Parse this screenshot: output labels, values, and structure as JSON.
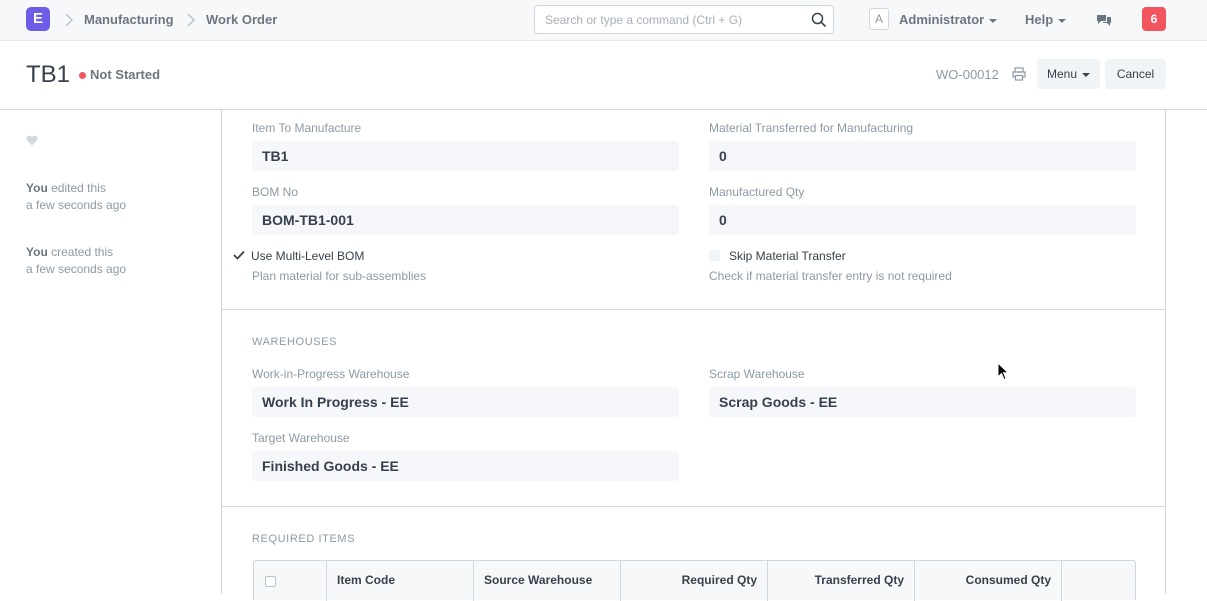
{
  "navbar": {
    "logo_letter": "E",
    "breadcrumbs": [
      "Manufacturing",
      "Work Order"
    ],
    "search_placeholder": "Search or type a command (Ctrl + G)",
    "avatar_letter": "A",
    "user": "Administrator",
    "help": "Help",
    "notification_count": "6"
  },
  "page": {
    "title": "TB1",
    "status": "Not Started",
    "docname": "WO-00012",
    "menu_label": "Menu",
    "cancel_label": "Cancel"
  },
  "sidebar": {
    "activities": [
      {
        "who": "You",
        "action": " edited this",
        "when": "a few seconds ago"
      },
      {
        "who": "You",
        "action": " created this",
        "when": "a few seconds ago"
      }
    ]
  },
  "form": {
    "item_to_manufacture": {
      "label": "Item To Manufacture",
      "value": "TB1"
    },
    "material_transferred": {
      "label": "Material Transferred for Manufacturing",
      "value": "0"
    },
    "bom_no": {
      "label": "BOM No",
      "value": "BOM-TB1-001"
    },
    "manufactured_qty": {
      "label": "Manufactured Qty",
      "value": "0"
    },
    "use_multi_level_bom": {
      "label": "Use Multi-Level BOM",
      "checked": true,
      "help": "Plan material for sub-assemblies"
    },
    "skip_material_transfer": {
      "label": "Skip Material Transfer",
      "checked": false,
      "help": "Check if material transfer entry is not required"
    },
    "warehouses": {
      "section": "WAREHOUSES",
      "wip": {
        "label": "Work-in-Progress Warehouse",
        "value": "Work In Progress - EE"
      },
      "scrap": {
        "label": "Scrap Warehouse",
        "value": "Scrap Goods - EE"
      },
      "target": {
        "label": "Target Warehouse",
        "value": "Finished Goods - EE"
      }
    },
    "required_items": {
      "section": "REQUIRED ITEMS",
      "columns": [
        "Item Code",
        "Source Warehouse",
        "Required Qty",
        "Transferred Qty",
        "Consumed Qty"
      ]
    }
  },
  "colors": {
    "logo": "#6c5ce7",
    "status_red": "#f2555e",
    "notification": "#f2555e"
  }
}
